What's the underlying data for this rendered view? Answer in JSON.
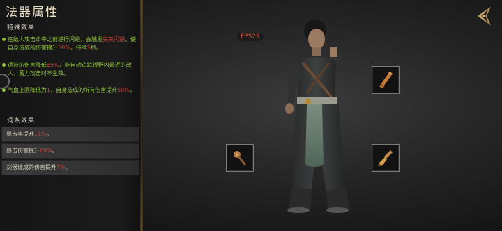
{
  "panel": {
    "title": "法器属性",
    "special_header": "特殊效果",
    "effects": [
      {
        "a": "在敌人攻击命中之前进行闪避，会触发",
        "r1": "完美闪避",
        "b": "，使自身造成的伤害提升",
        "r2": "50%",
        "c": "，持续",
        "r3": "5",
        "d": "秒。"
      },
      {
        "a": "遗符的伤害降低",
        "r1": "85%",
        "b": "，能自动追踪视野内最近的敌人，蓄力攻击时不生效。"
      },
      {
        "a": "气血上限降低为",
        "r1": "1",
        "b": "，自身造成的所有伤害提升",
        "r2": "50%",
        "c": "。"
      }
    ],
    "entry_header": "词条效果",
    "entries": [
      {
        "a": "暴击率提升",
        "r": "11%",
        "b": "。"
      },
      {
        "a": "暴击伤害提升",
        "r": "69%",
        "b": "。"
      },
      {
        "a": "剑器造成的伤害提升",
        "r": "7%",
        "b": "。"
      }
    ]
  },
  "hud": {
    "fps": "FPS29"
  },
  "equipment_slots": [
    {
      "name": "scroll-item-icon"
    },
    {
      "name": "staff-item-icon"
    },
    {
      "name": "brush-item-icon"
    }
  ],
  "colors": {
    "effect_green": "#8fc23d",
    "highlight_red": "#c94335",
    "gold": "#b8925a"
  }
}
